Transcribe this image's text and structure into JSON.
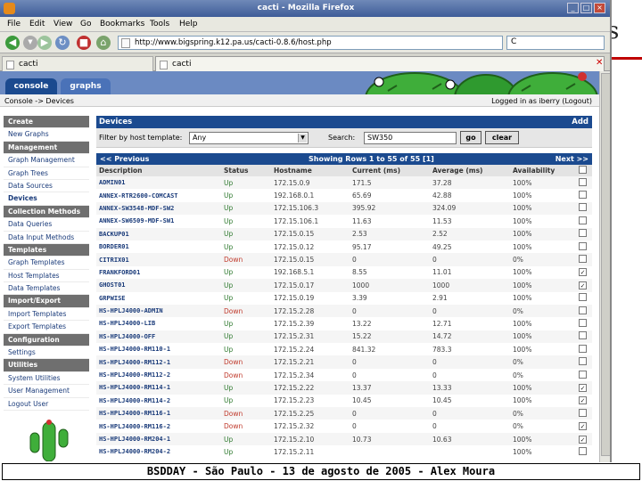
{
  "slide": {
    "caption": "BSDDAY - São Paulo - 13 de agosto de 2005 - Alex Moura",
    "title_fragment": "s"
  },
  "window": {
    "title": "cacti - Mozilla Firefox"
  },
  "menu": [
    "File",
    "Edit",
    "View",
    "Go",
    "Bookmarks",
    "Tools",
    "Help"
  ],
  "nav": {
    "url": "http://www.bigspring.k12.pa.us/cacti-0.8.6/host.php",
    "search_value": "C"
  },
  "tabs": [
    "cacti",
    "cacti"
  ],
  "cacti": {
    "tabs": [
      "console",
      "graphs"
    ],
    "breadcrumb": "Console -> Devices",
    "login": "Logged in as iberry (Logout)",
    "sidebar": [
      {
        "label": "Create",
        "head": true
      },
      {
        "label": "New Graphs",
        "head": false
      },
      {
        "label": "Management",
        "head": true
      },
      {
        "label": "Graph Management",
        "head": false
      },
      {
        "label": "Graph Trees",
        "head": false
      },
      {
        "label": "Data Sources",
        "head": false
      },
      {
        "label": "Devices",
        "head": false,
        "bold": true
      },
      {
        "label": "Collection Methods",
        "head": true
      },
      {
        "label": "Data Queries",
        "head": false
      },
      {
        "label": "Data Input Methods",
        "head": false
      },
      {
        "label": "Templates",
        "head": true
      },
      {
        "label": "Graph Templates",
        "head": false
      },
      {
        "label": "Host Templates",
        "head": false
      },
      {
        "label": "Data Templates",
        "head": false
      },
      {
        "label": "Import/Export",
        "head": true
      },
      {
        "label": "Import Templates",
        "head": false
      },
      {
        "label": "Export Templates",
        "head": false
      },
      {
        "label": "Configuration",
        "head": true
      },
      {
        "label": "Settings",
        "head": false
      },
      {
        "label": "Utilities",
        "head": true
      },
      {
        "label": "System Utilities",
        "head": false
      },
      {
        "label": "User Management",
        "head": false
      },
      {
        "label": "Logout User",
        "head": false
      }
    ],
    "devices": {
      "title": "Devices",
      "add_label": "Add",
      "filter_label": "Filter by host template:",
      "filter_value": "Any",
      "search_label": "Search:",
      "search_value": "SW350",
      "go_label": "go",
      "clear_label": "clear",
      "prev_label": "<< Previous",
      "rows_info": "Showing Rows 1 to 55 of 55 [1]",
      "next_label": "Next >>",
      "columns": [
        "Description",
        "Status",
        "Hostname",
        "Current (ms)",
        "Average (ms)",
        "Availability"
      ],
      "rows": [
        {
          "desc": "ADMIN01",
          "status": "Up",
          "host": "172.15.0.9",
          "cur": "171.5",
          "avg": "37.28",
          "avail": "100%",
          "checked": false
        },
        {
          "desc": "ANNEX-RTR2600-COMCAST",
          "status": "Up",
          "host": "192.168.0.1",
          "cur": "65.69",
          "avg": "42.88",
          "avail": "100%",
          "checked": false
        },
        {
          "desc": "ANNEX-SW3548-MDF-SW2",
          "status": "Up",
          "host": "172.15.106.3",
          "cur": "395.92",
          "avg": "324.09",
          "avail": "100%",
          "checked": false
        },
        {
          "desc": "ANNEX-SW6509-MDF-SW1",
          "status": "Up",
          "host": "172.15.106.1",
          "cur": "11.63",
          "avg": "11.53",
          "avail": "100%",
          "checked": false
        },
        {
          "desc": "BACKUP01",
          "status": "Up",
          "host": "172.15.0.15",
          "cur": "2.53",
          "avg": "2.52",
          "avail": "100%",
          "checked": false
        },
        {
          "desc": "BORDER01",
          "status": "Up",
          "host": "172.15.0.12",
          "cur": "95.17",
          "avg": "49.25",
          "avail": "100%",
          "checked": false
        },
        {
          "desc": "CITRIX01",
          "status": "Down",
          "host": "172.15.0.15",
          "cur": "0",
          "avg": "0",
          "avail": "0%",
          "checked": false
        },
        {
          "desc": "FRANKFORD01",
          "status": "Up",
          "host": "192.168.5.1",
          "cur": "8.55",
          "avg": "11.01",
          "avail": "100%",
          "checked": true
        },
        {
          "desc": "GHOST01",
          "status": "Up",
          "host": "172.15.0.17",
          "cur": "1000",
          "avg": "1000",
          "avail": "100%",
          "checked": true
        },
        {
          "desc": "GRPWISE",
          "status": "Up",
          "host": "172.15.0.19",
          "cur": "3.39",
          "avg": "2.91",
          "avail": "100%",
          "checked": false
        },
        {
          "desc": "HS-HPLJ4000-ADMIN",
          "status": "Down",
          "host": "172.15.2.28",
          "cur": "0",
          "avg": "0",
          "avail": "0%",
          "checked": false
        },
        {
          "desc": "HS-HPLJ4000-LIB",
          "status": "Up",
          "host": "172.15.2.39",
          "cur": "13.22",
          "avg": "12.71",
          "avail": "100%",
          "checked": false
        },
        {
          "desc": "HS-HPLJ4000-OFF",
          "status": "Up",
          "host": "172.15.2.31",
          "cur": "15.22",
          "avg": "14.72",
          "avail": "100%",
          "checked": false
        },
        {
          "desc": "HS-HPLJ4000-RM110-1",
          "status": "Up",
          "host": "172.15.2.24",
          "cur": "841.32",
          "avg": "783.3",
          "avail": "100%",
          "checked": false
        },
        {
          "desc": "HS-HPLJ4000-RM112-1",
          "status": "Down",
          "host": "172.15.2.21",
          "cur": "0",
          "avg": "0",
          "avail": "0%",
          "checked": false
        },
        {
          "desc": "HS-HPLJ4000-RM112-2",
          "status": "Down",
          "host": "172.15.2.34",
          "cur": "0",
          "avg": "0",
          "avail": "0%",
          "checked": false
        },
        {
          "desc": "HS-HPLJ4000-RM114-1",
          "status": "Up",
          "host": "172.15.2.22",
          "cur": "13.37",
          "avg": "13.33",
          "avail": "100%",
          "checked": true
        },
        {
          "desc": "HS-HPLJ4000-RM114-2",
          "status": "Up",
          "host": "172.15.2.23",
          "cur": "10.45",
          "avg": "10.45",
          "avail": "100%",
          "checked": true
        },
        {
          "desc": "HS-HPLJ4000-RM116-1",
          "status": "Down",
          "host": "172.15.2.25",
          "cur": "0",
          "avg": "0",
          "avail": "0%",
          "checked": false
        },
        {
          "desc": "HS-HPLJ4000-RM116-2",
          "status": "Down",
          "host": "172.15.2.32",
          "cur": "0",
          "avg": "0",
          "avail": "0%",
          "checked": true
        },
        {
          "desc": "HS-HPLJ4000-RM204-1",
          "status": "Up",
          "host": "172.15.2.10",
          "cur": "10.73",
          "avg": "10.63",
          "avail": "100%",
          "checked": true
        },
        {
          "desc": "HS-HPLJ4000-RM204-2",
          "status": "Up",
          "host": "172.15.2.11",
          "cur": "",
          "avg": "",
          "avail": "100%",
          "checked": false
        }
      ]
    }
  },
  "colors": {
    "cacti_blue": "#1b4a8f",
    "header_blue": "#6b8ac2",
    "up_green": "#2f7a2f",
    "down_red": "#c0392b",
    "slide_red": "#c00000"
  }
}
